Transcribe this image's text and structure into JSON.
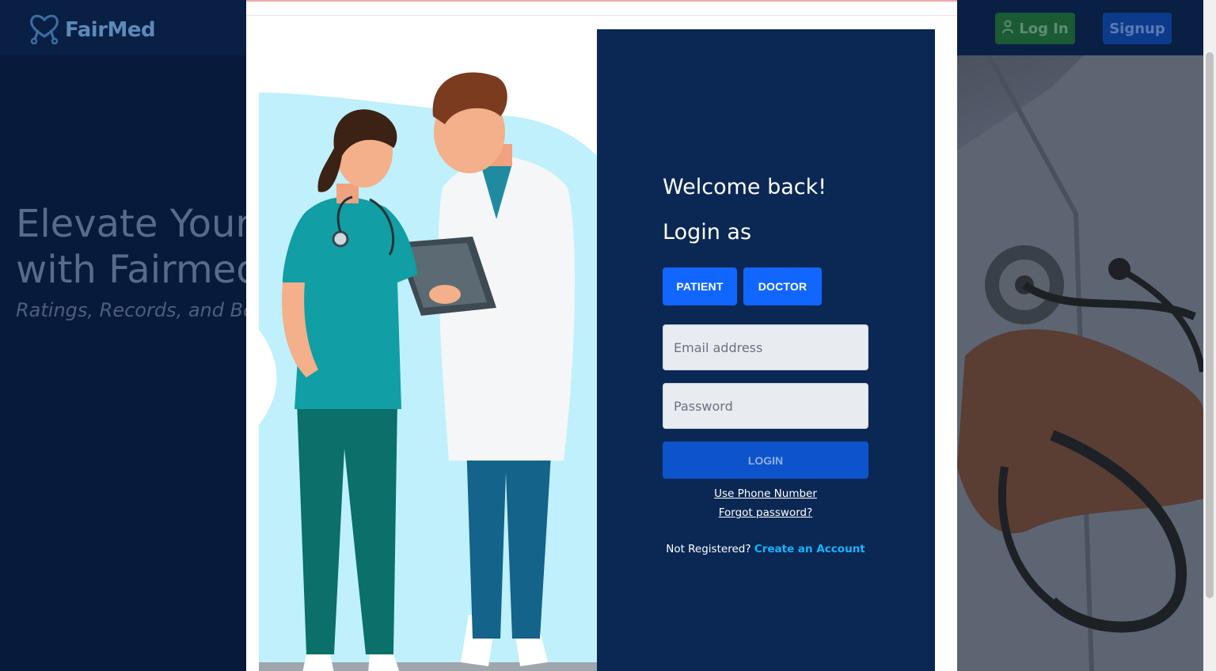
{
  "background": {
    "brand": "FairMed",
    "nav": {
      "login_label": "Log In",
      "signup_label": "Signup"
    },
    "hero": {
      "title_line1": "Elevate Your",
      "title_line2": "with Fairmed",
      "subtitle": "Ratings, Records, and Be"
    }
  },
  "modal": {
    "welcome": "Welcome back!",
    "login_as": "Login as",
    "roles": {
      "patient": "PATIENT",
      "doctor": "DOCTOR"
    },
    "email": {
      "placeholder": "Email address"
    },
    "password": {
      "placeholder": "Password"
    },
    "login_label": "LOGIN",
    "phone_link": "Use Phone Number",
    "forgot_link": "Forgot password?",
    "not_registered": "Not Registered?",
    "create_account": "Create an Account"
  },
  "colors": {
    "panel": "#0a2853",
    "primary": "#1166ff",
    "link": "#18b4ff",
    "nav_login": "#1a5a34",
    "nav_signup": "#0d3a8a"
  },
  "icons": [
    "heart-stethoscope-icon",
    "user-icon"
  ]
}
